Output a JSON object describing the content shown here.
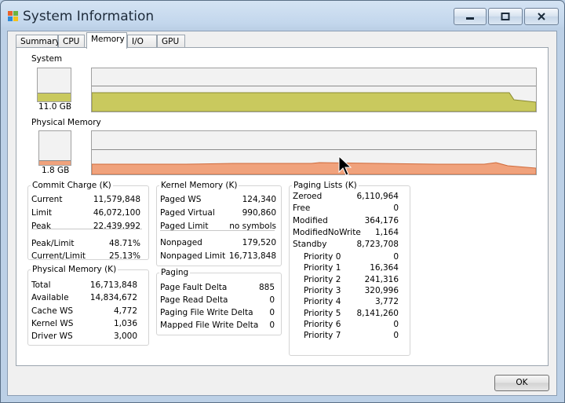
{
  "window": {
    "title": "System Information"
  },
  "tabs": [
    "Summary",
    "CPU",
    "Memory",
    "I/O",
    "GPU"
  ],
  "active_tab": "Memory",
  "system": {
    "label": "System",
    "value": "11.0 GB",
    "level": 0.24,
    "color": "#c9c95e"
  },
  "physical": {
    "label": "Physical Memory",
    "value": "1.8 GB",
    "level": 0.12,
    "color": "#f0a27c"
  },
  "commit": {
    "title": "Commit Charge (K)",
    "rows1": [
      [
        "Current",
        "11,579,848"
      ],
      [
        "Limit",
        "46,072,100"
      ],
      [
        "Peak",
        "22,439,992"
      ]
    ],
    "rows2": [
      [
        "Peak/Limit",
        "48.71%"
      ],
      [
        "Current/Limit",
        "25.13%"
      ]
    ]
  },
  "physmem": {
    "title": "Physical Memory (K)",
    "rows": [
      [
        "Total",
        "16,713,848"
      ],
      [
        "Available",
        "14,834,672"
      ],
      [
        "Cache WS",
        "4,772"
      ],
      [
        "Kernel WS",
        "1,036"
      ],
      [
        "Driver WS",
        "3,000"
      ]
    ]
  },
  "kernel": {
    "title": "Kernel Memory (K)",
    "rows1": [
      [
        "Paged WS",
        "124,340"
      ],
      [
        "Paged Virtual",
        "990,860"
      ],
      [
        "Paged Limit",
        "no symbols"
      ]
    ],
    "rows2": [
      [
        "Nonpaged",
        "179,520"
      ],
      [
        "Nonpaged Limit",
        "16,713,848"
      ]
    ]
  },
  "paging": {
    "title": "Paging",
    "rows": [
      [
        "Page Fault Delta",
        "885"
      ],
      [
        "Page Read Delta",
        "0"
      ],
      [
        "Paging File Write Delta",
        "0"
      ],
      [
        "Mapped File Write Delta",
        "0"
      ]
    ]
  },
  "paginglists": {
    "title": "Paging Lists (K)",
    "rows": [
      [
        "Zeroed",
        "6,110,964"
      ],
      [
        "Free",
        "0"
      ],
      [
        "Modified",
        "364,176"
      ],
      [
        "ModifiedNoWrite",
        "1,164"
      ],
      [
        "Standby",
        "8,723,708"
      ]
    ],
    "priorities": [
      [
        "Priority 0",
        "0"
      ],
      [
        "Priority 1",
        "16,364"
      ],
      [
        "Priority 2",
        "241,316"
      ],
      [
        "Priority 3",
        "320,996"
      ],
      [
        "Priority 4",
        "3,772"
      ],
      [
        "Priority 5",
        "8,141,260"
      ],
      [
        "Priority 6",
        "0"
      ],
      [
        "Priority 7",
        "0"
      ]
    ]
  },
  "ok_label": "OK"
}
